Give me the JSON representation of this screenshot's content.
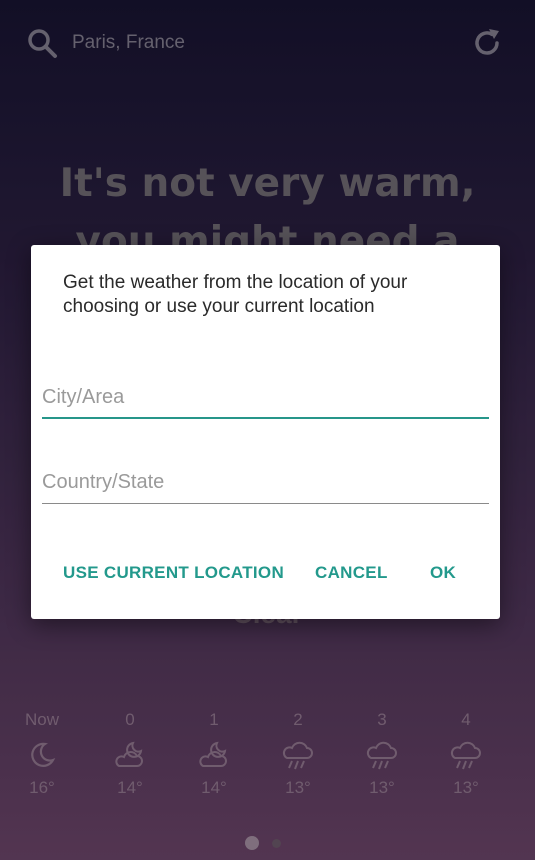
{
  "header": {
    "location": "Paris, France"
  },
  "main": {
    "headline_line1": "It's not very warm,",
    "headline_line2": "you might need a",
    "condition": "Clear"
  },
  "forecast": [
    {
      "label": "Now",
      "icon": "moon-icon",
      "temp": "16°"
    },
    {
      "label": "0",
      "icon": "cloud-moon-icon",
      "temp": "14°"
    },
    {
      "label": "1",
      "icon": "cloud-moon-icon",
      "temp": "14°"
    },
    {
      "label": "2",
      "icon": "cloud-rain-icon",
      "temp": "13°"
    },
    {
      "label": "3",
      "icon": "cloud-rain-icon",
      "temp": "13°"
    },
    {
      "label": "4",
      "icon": "cloud-rain-icon",
      "temp": "13°"
    }
  ],
  "pager": {
    "pages": 2,
    "current": 1
  },
  "dialog": {
    "message": "Get the weather from the location of your choosing or use your current location",
    "city_placeholder": "City/Area",
    "city_value": "",
    "country_placeholder": "Country/State",
    "country_value": "",
    "use_current_label": "USE CURRENT LOCATION",
    "cancel_label": "CANCEL",
    "ok_label": "OK"
  },
  "colors": {
    "accent": "#23998c",
    "background_top": "#14112a",
    "background_bottom": "#5a3a58"
  }
}
